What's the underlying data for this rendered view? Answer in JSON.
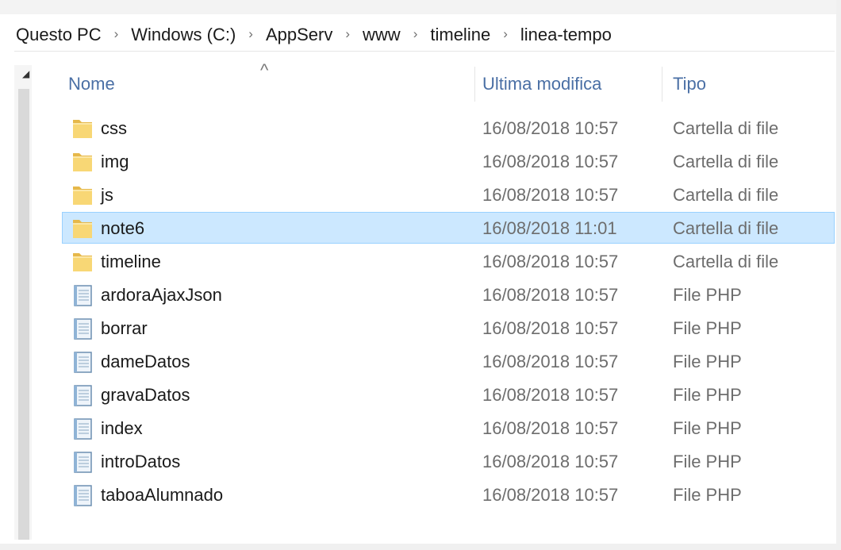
{
  "breadcrumb": {
    "items": [
      "Questo PC",
      "Windows (C:)",
      "AppServ",
      "www",
      "timeline",
      "linea-tempo"
    ],
    "separator": "›"
  },
  "columns": {
    "name": "Nome",
    "modified": "Ultima modifica",
    "type": "Tipo",
    "sort_indicator": "^"
  },
  "files": [
    {
      "name": "css",
      "modified": "16/08/2018 10:57",
      "type": "Cartella di file",
      "icon": "folder-icon"
    },
    {
      "name": "img",
      "modified": "16/08/2018 10:57",
      "type": "Cartella di file",
      "icon": "folder-icon"
    },
    {
      "name": "js",
      "modified": "16/08/2018 10:57",
      "type": "Cartella di file",
      "icon": "folder-icon"
    },
    {
      "name": "note6",
      "modified": "16/08/2018 11:01",
      "type": "Cartella di file",
      "icon": "folder-icon",
      "selected": true
    },
    {
      "name": "timeline",
      "modified": "16/08/2018 10:57",
      "type": "Cartella di file",
      "icon": "folder-icon"
    },
    {
      "name": "ardoraAjaxJson",
      "modified": "16/08/2018 10:57",
      "type": "File PHP",
      "icon": "php-file-icon"
    },
    {
      "name": "borrar",
      "modified": "16/08/2018 10:57",
      "type": "File PHP",
      "icon": "php-file-icon"
    },
    {
      "name": "dameDatos",
      "modified": "16/08/2018 10:57",
      "type": "File PHP",
      "icon": "php-file-icon"
    },
    {
      "name": "gravaDatos",
      "modified": "16/08/2018 10:57",
      "type": "File PHP",
      "icon": "php-file-icon"
    },
    {
      "name": "index",
      "modified": "16/08/2018 10:57",
      "type": "File PHP",
      "icon": "php-file-icon"
    },
    {
      "name": "introDatos",
      "modified": "16/08/2018 10:57",
      "type": "File PHP",
      "icon": "php-file-icon"
    },
    {
      "name": "taboaAlumnado",
      "modified": "16/08/2018 10:57",
      "type": "File PHP",
      "icon": "php-file-icon"
    }
  ],
  "colors": {
    "selection_bg": "#cce8ff",
    "selection_border": "#99d1ff",
    "header_text": "#4a6fa5",
    "folder": "#f8d775"
  }
}
